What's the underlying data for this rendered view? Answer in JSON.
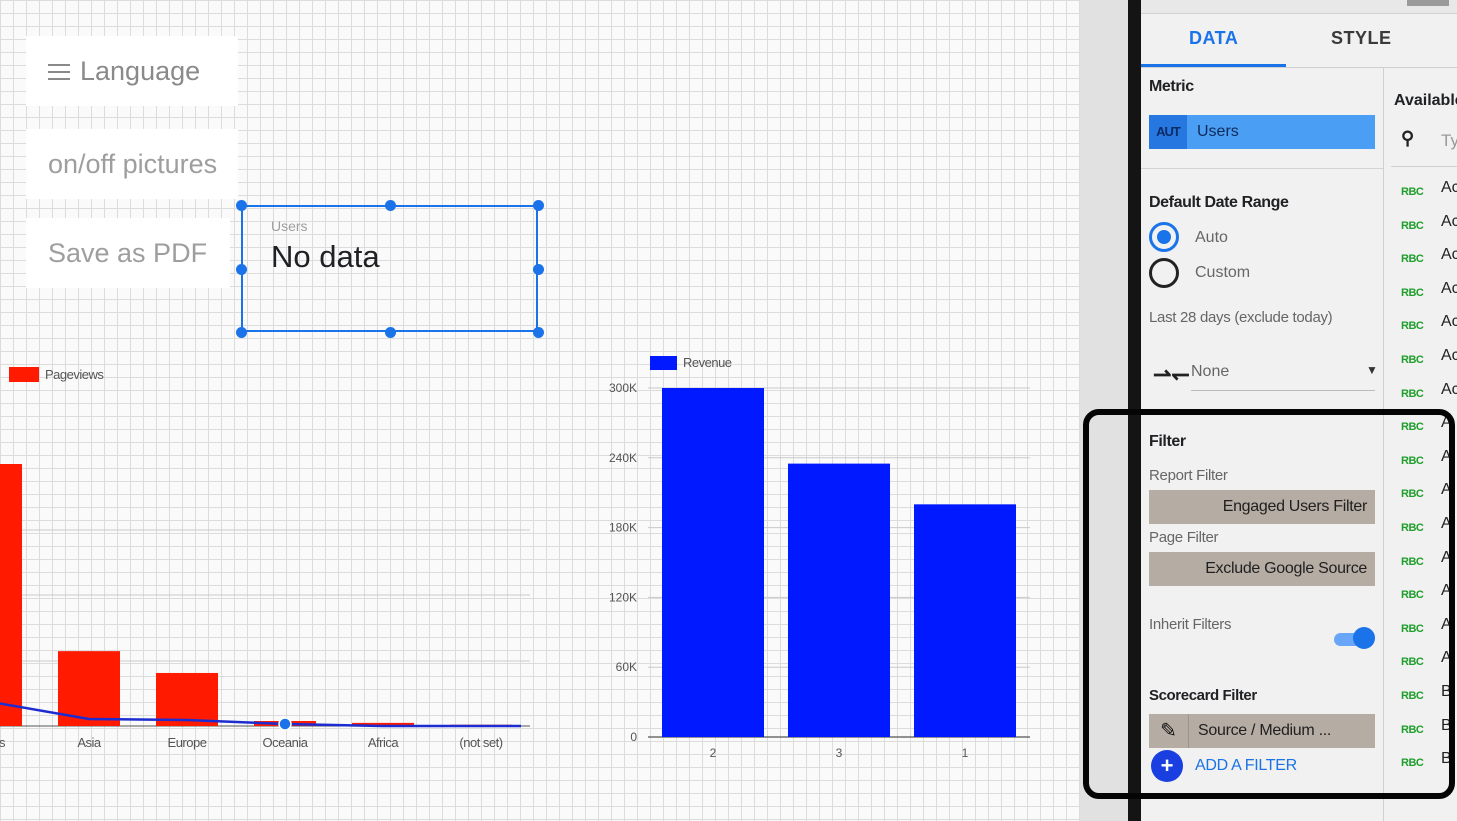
{
  "canvas": {
    "buttons": {
      "language": "Language",
      "pictures": "on/off pictures",
      "pdf": "Save as PDF"
    },
    "scorecard": {
      "label": "Users",
      "value": "No data"
    }
  },
  "charts": {
    "pageviews": {
      "legend": "Pageviews",
      "color": "#ff1a00",
      "line_color": "#1d2cd0"
    },
    "revenue": {
      "legend": "Revenue",
      "color": "#0019ff"
    }
  },
  "chart_data": [
    {
      "type": "bar",
      "series": [
        {
          "name": "Pageviews",
          "values": [
            420,
            120,
            85,
            8,
            5,
            2
          ]
        }
      ],
      "line": [
        40,
        10,
        8,
        2,
        1,
        0
      ],
      "categories": [
        "...cas",
        "Asia",
        "Europe",
        "Oceania",
        "Africa",
        "(not set)"
      ],
      "legend": "top-left"
    },
    {
      "type": "bar",
      "categories": [
        "2",
        "3",
        "1"
      ],
      "series": [
        {
          "name": "Revenue",
          "values": [
            300000,
            235000,
            200000
          ]
        }
      ],
      "yticks": [
        "0",
        "60K",
        "120K",
        "180K",
        "240K",
        "300K"
      ],
      "ylim": [
        0,
        300000
      ],
      "legend": "top-left"
    }
  ],
  "panel": {
    "tabs": {
      "data": "DATA",
      "style": "STYLE"
    },
    "metric": {
      "title": "Metric",
      "badge": "AUT",
      "name": "Users"
    },
    "date_range": {
      "title": "Default Date Range",
      "auto": "Auto",
      "custom": "Custom",
      "note": "Last 28 days (exclude today)",
      "compare": "None"
    },
    "filter": {
      "title": "Filter",
      "report_filter_label": "Report Filter",
      "report_filter": "Engaged Users Filter",
      "page_filter_label": "Page Filter",
      "page_filter": "Exclude Google Source",
      "inherit_label": "Inherit Filters",
      "scorecard_filter_label": "Scorecard Filter",
      "scorecard_filter": "Source / Medium ...",
      "add_filter": "ADD A FILTER"
    },
    "available": {
      "title": "Available",
      "search_placeholder": "Ty",
      "type_badge": "RBC",
      "rows": [
        "Ac",
        "Ac",
        "Ac",
        "Ac",
        "Ac",
        "Ac",
        "Ac",
        "A",
        "A",
        "A",
        "A",
        "A",
        "A",
        "A",
        "A",
        "B",
        "B",
        "B"
      ]
    }
  }
}
